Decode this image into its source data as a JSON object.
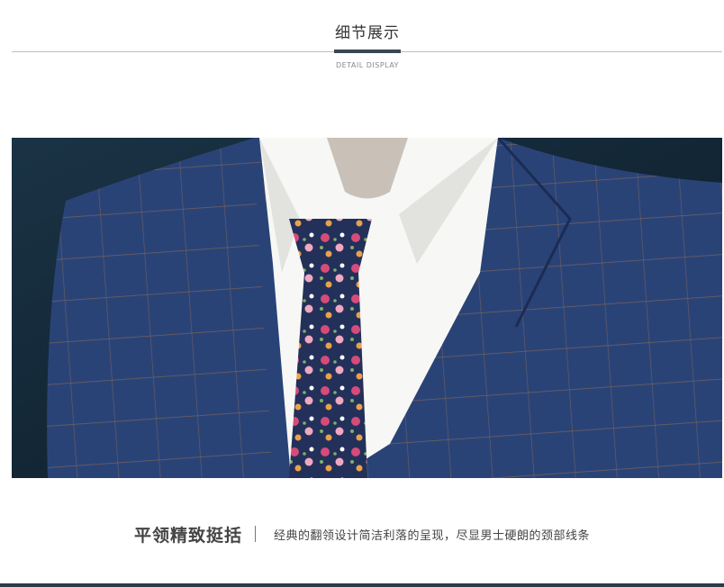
{
  "header": {
    "title": "细节展示",
    "subtitle": "DETAIL DISPLAY"
  },
  "photo": {
    "subject": "suit-collar-detail-image",
    "colors": {
      "background": "#102233",
      "suit_navy": "#2a4377",
      "check_line": "#8a6a55",
      "shirt": "#f7f7f5",
      "tie": "#23305a",
      "mannequin": "#c9c1b8"
    }
  },
  "caption": {
    "title": "平领精致挺括",
    "description": "经典的翻领设计简洁利落的呈现，尽显男士硬朗的颈部线条"
  }
}
